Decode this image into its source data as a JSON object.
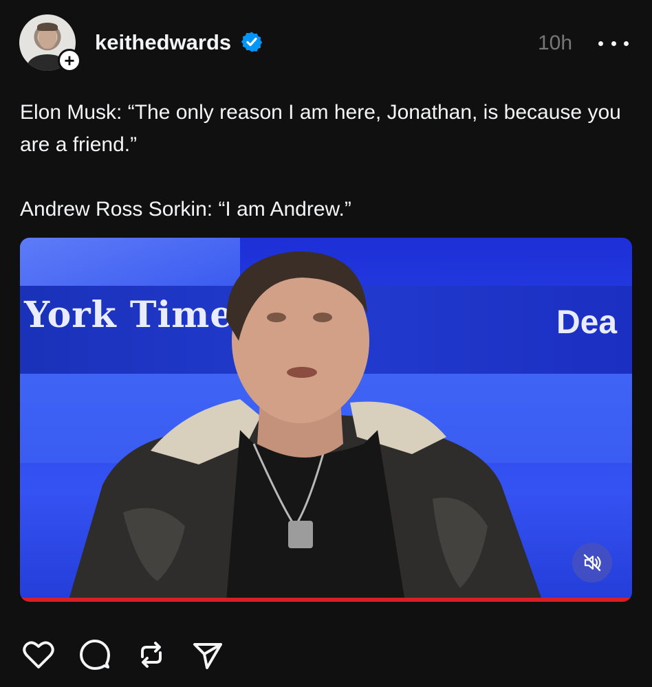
{
  "post": {
    "username": "keithedwards",
    "verified_icon": "verified-badge-icon",
    "timestamp": "10h",
    "more_icon": "more-options-icon",
    "follow_icon": "plus-icon",
    "caption": [
      "Elon Musk: “The only reason I am here, Jonathan, is because you are a friend.”",
      "",
      "Andrew Ross Sorkin: “I am Andrew.”"
    ]
  },
  "media": {
    "type": "video",
    "backdrop_text_left": "York Times",
    "backdrop_text_right": "Dea",
    "muted": true,
    "mute_icon": "muted-speaker-icon"
  },
  "actions": [
    {
      "name": "like",
      "icon": "heart-icon"
    },
    {
      "name": "comment",
      "icon": "comment-icon"
    },
    {
      "name": "repost",
      "icon": "repost-icon"
    },
    {
      "name": "share",
      "icon": "send-icon"
    }
  ],
  "colors": {
    "background": "#101010",
    "text": "#f3f5f7",
    "muted_text": "#777777",
    "verified_blue": "#0095f6",
    "video_blue": "#2b49ee",
    "progress_red": "#d81f26"
  }
}
